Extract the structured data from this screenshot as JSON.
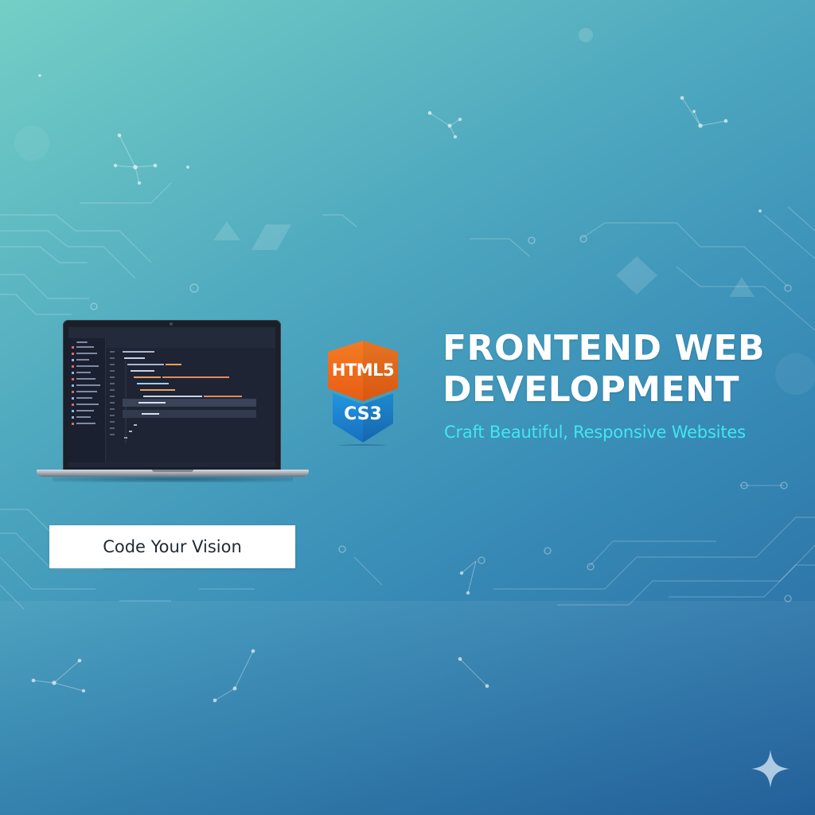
{
  "hero": {
    "title_line1": "FRONTEND WEB",
    "title_line2": "DEVELOPMENT",
    "subtitle": "Craft Beautiful, Responsive Websites"
  },
  "badge": {
    "top_label": "HTML5",
    "bottom_label": "CS3"
  },
  "cta": {
    "label": "Code Your Vision"
  },
  "colors": {
    "background_start": "#74cfc6",
    "background_end": "#2566a0",
    "subtitle": "#43e6f0",
    "badge_orange": "#f36f21",
    "badge_blue": "#1d86d4"
  },
  "icons": {
    "corner": "sparkle-icon",
    "device": "laptop-icon"
  }
}
